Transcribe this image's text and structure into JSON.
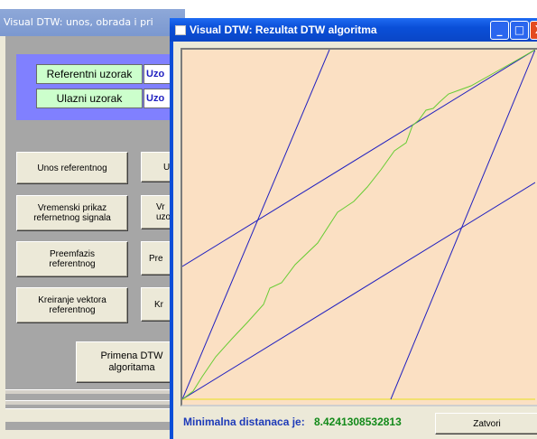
{
  "back_window": {
    "title": "Visual DTW: unos, obrada i pri",
    "fields": [
      {
        "label": "Referentni uzorak",
        "value": "Uzo"
      },
      {
        "label": "Ulazni uzorak",
        "value": "Uzo"
      }
    ],
    "buttons": {
      "unos_referentnog": "Unos referentnog",
      "unos_ulaznog": "U",
      "vremenski_ref_l1": "Vremenski prikaz",
      "vremenski_ref_l2": "refernetnog signala",
      "vremenski_ul_l1": "Vr",
      "vremenski_ul_l2": "uzor",
      "preemfazis_ref_l1": "Preemfazis",
      "preemfazis_ref_l2": "referentnog",
      "preemfazis_ul": "Pre",
      "kreiranje_ref_l1": "Kreiranje vektora",
      "kreiranje_ref_l2": "referentnog",
      "kreiranje_ul": "Kr",
      "primena_l1": "Primena DTW",
      "primena_l2": "algoritama"
    }
  },
  "front_window": {
    "title": "Visual DTW: Rezultat DTW algoritma",
    "title_buttons": [
      "_",
      "□",
      "X"
    ],
    "status_label": "Minimalna distanaca je:",
    "status_value": "8.4241308532813",
    "close_button": "Zatvori"
  },
  "plot": {
    "background": "#fbe0c3",
    "boundary_color": "#2020c0",
    "path_color": "#66cc33",
    "bottom_line_color": "#f2e070"
  }
}
